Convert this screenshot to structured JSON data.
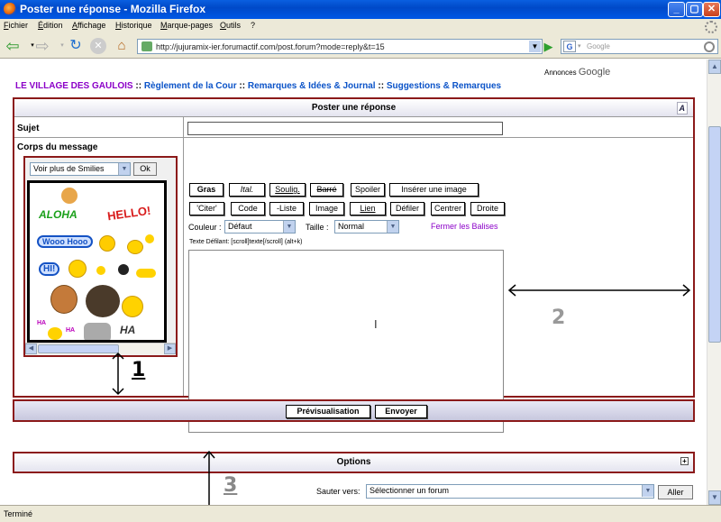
{
  "window": {
    "title": "Poster une réponse - Mozilla Firefox",
    "min": "_",
    "max": "▢",
    "close": "✕"
  },
  "menu": [
    "Fichier",
    "Édition",
    "Affichage",
    "Historique",
    "Marque-pages",
    "Outils",
    "?"
  ],
  "nav": {
    "url": "http://jujuramix-ier.forumactif.com/post.forum?mode=reply&t=15",
    "search_placeholder": "Google",
    "search_engine": "G"
  },
  "page": {
    "ads_prefix": "Annonces",
    "ads_brand": "Google",
    "breadcrumb": {
      "home": "LE VILLAGE DES GAULOIS",
      "sep": "::",
      "items": [
        "Règlement de la Cour",
        "Remarques & Idées & Journal",
        "Suggestions & Remarques"
      ]
    },
    "form": {
      "header": "Poster une réponse",
      "font_toggle": "A",
      "subject_label": "Sujet",
      "body_label": "Corps du message",
      "smilies_select": "Voir plus de Smilies",
      "smilies_ok": "Ok",
      "smilies": {
        "aloha": "ALOHA",
        "hello": "HELLO!",
        "wooo": "Wooo Hooo",
        "hi": "HI!",
        "ha1": "HA",
        "ha2": "HA",
        "ha3": "HA"
      },
      "toolbar_row1": [
        "Gras",
        "Ital.",
        "Soulig.",
        "Barré",
        "Spoiler",
        "Insérer une image"
      ],
      "toolbar_row2": [
        "'Citer'",
        "Code",
        "-Liste",
        "Image",
        "Lien",
        "Défiler",
        "Centrer",
        "Droite"
      ],
      "color_label": "Couleur :",
      "color_value": "Défaut",
      "size_label": "Taille :",
      "size_value": "Normal",
      "close_tags": "Fermer les Balises",
      "hint": "Texte Défilant: [scroll]texte[/scroll]  (alt+k)",
      "preview_button": "Prévisualisation",
      "send_button": "Envoyer"
    },
    "options": {
      "label": "Options",
      "toggle": "+"
    },
    "jump": {
      "label": "Sauter vers:",
      "value": "Sélectionner un forum",
      "go": "Aller"
    }
  },
  "annotations": [
    "1",
    "2",
    "3"
  ],
  "status": "Terminé",
  "colors": {
    "titlebar": "#0058e6",
    "frame_border": "#8b1a1a",
    "link_blue": "#0b53c8",
    "link_purple": "#8b00c8",
    "chrome": "#ece9d8"
  }
}
